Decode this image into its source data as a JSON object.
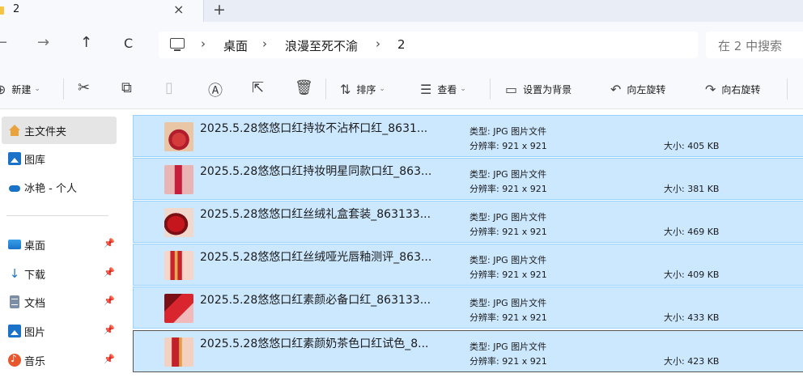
{
  "tab": {
    "title": "2",
    "close": "×",
    "new": "+"
  },
  "nav": {
    "back": "←",
    "forward": "→",
    "up": "↑",
    "refresh": "C",
    "breadcrumb": [
      "桌面",
      "浪漫至死不渝",
      "2"
    ],
    "separator": "›",
    "search_placeholder": "在 2 中搜索"
  },
  "commands": {
    "new_label": "新建",
    "sort_label": "排序",
    "view_label": "查看",
    "set_background_label": "设置为背景",
    "rotate_left_label": "向左旋转",
    "rotate_right_label": "向右旋转"
  },
  "sidebar": {
    "items": [
      {
        "label": "主文件夹",
        "icon": "home-icon"
      },
      {
        "label": "图库",
        "icon": "gallery-icon"
      },
      {
        "label": "冰艳 - 个人",
        "icon": "cloud-icon"
      }
    ],
    "pinned": [
      {
        "label": "桌面",
        "icon": "desktop-icon"
      },
      {
        "label": "下载",
        "icon": "download-icon"
      },
      {
        "label": "文档",
        "icon": "documents-icon"
      },
      {
        "label": "图片",
        "icon": "pictures-icon"
      },
      {
        "label": "音乐",
        "icon": "music-icon"
      }
    ]
  },
  "files": [
    {
      "name": "2025.5.28悠悠口红持妆不沾杯口红_8631...",
      "type": "类型: JPG 图片文件",
      "resolution": "分辨率: 921 x 921",
      "size": "大小: 405 KB"
    },
    {
      "name": "2025.5.28悠悠口红持妆明星同款口红_863...",
      "type": "类型: JPG 图片文件",
      "resolution": "分辨率: 921 x 921",
      "size": "大小: 381 KB"
    },
    {
      "name": "2025.5.28悠悠口红丝绒礼盒套装_863133...",
      "type": "类型: JPG 图片文件",
      "resolution": "分辨率: 921 x 921",
      "size": "大小: 469 KB"
    },
    {
      "name": "2025.5.28悠悠口红丝绒哑光唇釉测评_863...",
      "type": "类型: JPG 图片文件",
      "resolution": "分辨率: 921 x 921",
      "size": "大小: 409 KB"
    },
    {
      "name": "2025.5.28悠悠口红素颜必备口红_863133...",
      "type": "类型: JPG 图片文件",
      "resolution": "分辨率: 921 x 921",
      "size": "大小: 433 KB"
    },
    {
      "name": "2025.5.28悠悠口红素颜奶茶色口红试色_8...",
      "type": "类型: JPG 图片文件",
      "resolution": "分辨率: 921 x 921",
      "size": "大小: 423 KB"
    }
  ],
  "colors": {
    "selection": "#cce8ff",
    "selection_border": "#99d1ff",
    "accent": "#1a73c9"
  }
}
